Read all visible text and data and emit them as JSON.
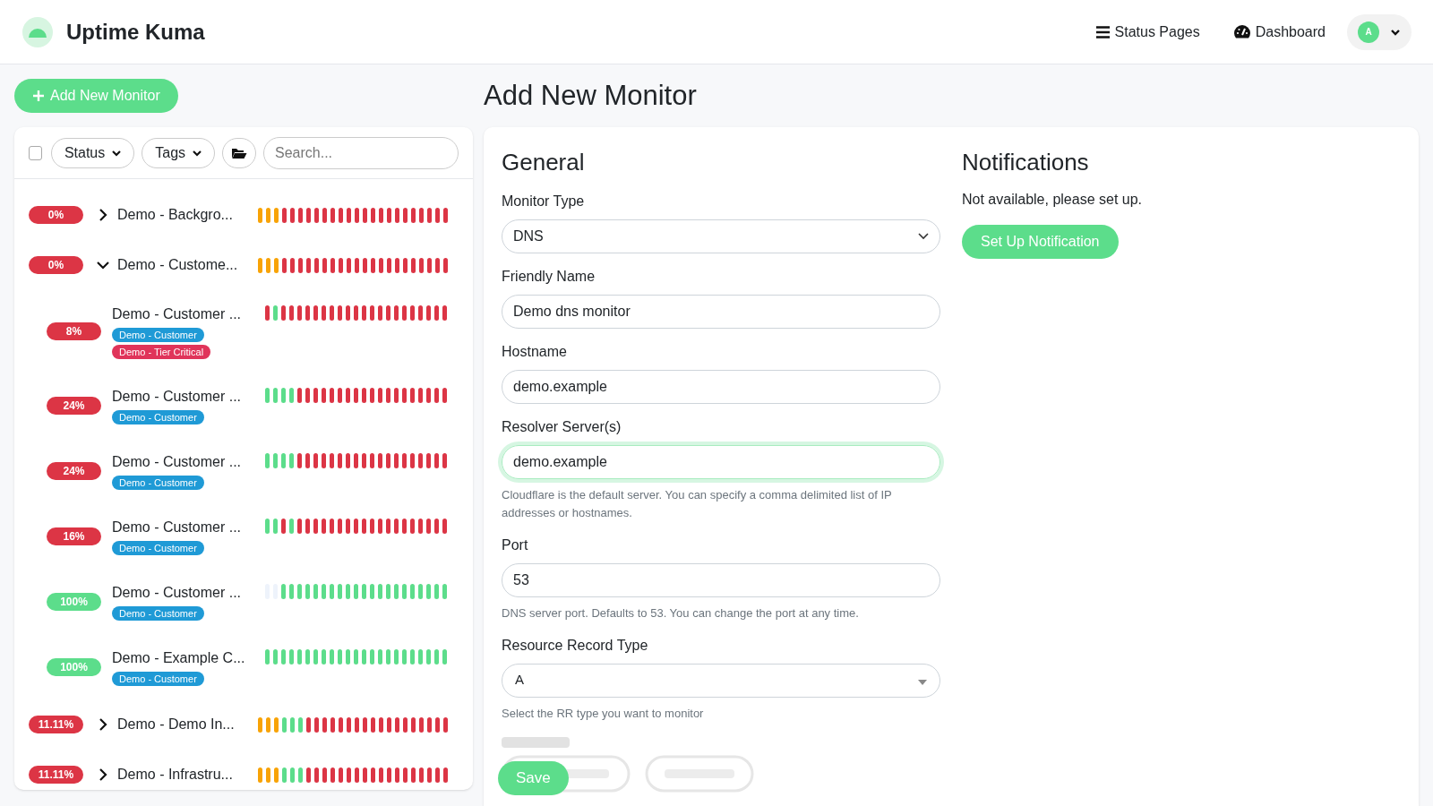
{
  "app": {
    "name": "Uptime Kuma"
  },
  "nav": [
    {
      "label": "Status Pages",
      "kind": "list"
    },
    {
      "label": "Dashboard",
      "kind": "gauge"
    }
  ],
  "user": {
    "initial": "A"
  },
  "add_button": "Add New Monitor",
  "filters": {
    "select_all_checked": false,
    "status": "Status",
    "tags": "Tags",
    "search_placeholder": "Search..."
  },
  "monitors": [
    {
      "uptime": "0%",
      "color": "#dc3545",
      "name": "Demo - Backgro...",
      "expanded": false,
      "beats": [
        {
          "color": "#f8a306"
        },
        {
          "color": "#f8a306"
        },
        {
          "color": "#f8a306"
        },
        {
          "color": "#dc3545"
        },
        {
          "color": "#dc3545"
        },
        {
          "color": "#dc3545"
        },
        {
          "color": "#dc3545"
        },
        {
          "color": "#dc3545"
        },
        {
          "color": "#dc3545"
        },
        {
          "color": "#dc3545"
        },
        {
          "color": "#dc3545"
        },
        {
          "color": "#dc3545"
        },
        {
          "color": "#dc3545"
        },
        {
          "color": "#dc3545"
        },
        {
          "color": "#dc3545"
        },
        {
          "color": "#dc3545"
        },
        {
          "color": "#dc3545"
        },
        {
          "color": "#dc3545"
        },
        {
          "color": "#dc3545"
        },
        {
          "color": "#dc3545"
        },
        {
          "color": "#dc3545"
        },
        {
          "color": "#dc3545"
        },
        {
          "color": "#dc3545"
        },
        {
          "color": "#dc3545"
        }
      ]
    },
    {
      "uptime": "0%",
      "color": "#dc3545",
      "name": "Demo - Custome...",
      "expanded": true,
      "beats": [
        {
          "color": "#f8a306"
        },
        {
          "color": "#f8a306"
        },
        {
          "color": "#f8a306"
        },
        {
          "color": "#dc3545"
        },
        {
          "color": "#dc3545"
        },
        {
          "color": "#dc3545"
        },
        {
          "color": "#dc3545"
        },
        {
          "color": "#dc3545"
        },
        {
          "color": "#dc3545"
        },
        {
          "color": "#dc3545"
        },
        {
          "color": "#dc3545"
        },
        {
          "color": "#dc3545"
        },
        {
          "color": "#dc3545"
        },
        {
          "color": "#dc3545"
        },
        {
          "color": "#dc3545"
        },
        {
          "color": "#dc3545"
        },
        {
          "color": "#dc3545"
        },
        {
          "color": "#dc3545"
        },
        {
          "color": "#dc3545"
        },
        {
          "color": "#dc3545"
        },
        {
          "color": "#dc3545"
        },
        {
          "color": "#dc3545"
        },
        {
          "color": "#dc3545"
        },
        {
          "color": "#dc3545"
        }
      ],
      "children": [
        {
          "uptime": "8%",
          "color": "#dc3545",
          "name": "Demo - Customer ...",
          "tags": [
            {
              "label": "Demo - Customer",
              "color": "#1f9ad6"
            },
            {
              "label": "Demo - Tier Critical",
              "color": "#e0345a"
            }
          ],
          "beats": [
            {
              "color": "#dc3545"
            },
            {
              "color": "#5cdd8b"
            },
            {
              "color": "#dc3545"
            },
            {
              "color": "#dc3545"
            },
            {
              "color": "#dc3545"
            },
            {
              "color": "#dc3545"
            },
            {
              "color": "#dc3545"
            },
            {
              "color": "#dc3545"
            },
            {
              "color": "#dc3545"
            },
            {
              "color": "#dc3545"
            },
            {
              "color": "#dc3545"
            },
            {
              "color": "#dc3545"
            },
            {
              "color": "#dc3545"
            },
            {
              "color": "#dc3545"
            },
            {
              "color": "#dc3545"
            },
            {
              "color": "#dc3545"
            },
            {
              "color": "#dc3545"
            },
            {
              "color": "#dc3545"
            },
            {
              "color": "#dc3545"
            },
            {
              "color": "#dc3545"
            },
            {
              "color": "#dc3545"
            },
            {
              "color": "#dc3545"
            },
            {
              "color": "#dc3545"
            }
          ]
        },
        {
          "uptime": "24%",
          "color": "#dc3545",
          "name": "Demo - Customer ...",
          "tags": [
            {
              "label": "Demo - Customer",
              "color": "#1f9ad6"
            }
          ],
          "beats": [
            {
              "color": "#5cdd8b"
            },
            {
              "color": "#5cdd8b"
            },
            {
              "color": "#5cdd8b"
            },
            {
              "color": "#5cdd8b"
            },
            {
              "color": "#dc3545"
            },
            {
              "color": "#dc3545"
            },
            {
              "color": "#dc3545"
            },
            {
              "color": "#dc3545"
            },
            {
              "color": "#dc3545"
            },
            {
              "color": "#dc3545"
            },
            {
              "color": "#dc3545"
            },
            {
              "color": "#dc3545"
            },
            {
              "color": "#dc3545"
            },
            {
              "color": "#dc3545"
            },
            {
              "color": "#dc3545"
            },
            {
              "color": "#dc3545"
            },
            {
              "color": "#dc3545"
            },
            {
              "color": "#dc3545"
            },
            {
              "color": "#dc3545"
            },
            {
              "color": "#dc3545"
            },
            {
              "color": "#dc3545"
            },
            {
              "color": "#dc3545"
            },
            {
              "color": "#dc3545"
            }
          ]
        },
        {
          "uptime": "24%",
          "color": "#dc3545",
          "name": "Demo - Customer ...",
          "tags": [
            {
              "label": "Demo - Customer",
              "color": "#1f9ad6"
            }
          ],
          "beats": [
            {
              "color": "#5cdd8b"
            },
            {
              "color": "#5cdd8b"
            },
            {
              "color": "#5cdd8b"
            },
            {
              "color": "#5cdd8b"
            },
            {
              "color": "#dc3545"
            },
            {
              "color": "#dc3545"
            },
            {
              "color": "#dc3545"
            },
            {
              "color": "#dc3545"
            },
            {
              "color": "#dc3545"
            },
            {
              "color": "#dc3545"
            },
            {
              "color": "#dc3545"
            },
            {
              "color": "#dc3545"
            },
            {
              "color": "#dc3545"
            },
            {
              "color": "#dc3545"
            },
            {
              "color": "#dc3545"
            },
            {
              "color": "#dc3545"
            },
            {
              "color": "#dc3545"
            },
            {
              "color": "#dc3545"
            },
            {
              "color": "#dc3545"
            },
            {
              "color": "#dc3545"
            },
            {
              "color": "#dc3545"
            },
            {
              "color": "#dc3545"
            },
            {
              "color": "#dc3545"
            }
          ]
        },
        {
          "uptime": "16%",
          "color": "#dc3545",
          "name": "Demo - Customer ...",
          "tags": [
            {
              "label": "Demo - Customer",
              "color": "#1f9ad6"
            }
          ],
          "beats": [
            {
              "color": "#5cdd8b"
            },
            {
              "color": "#5cdd8b"
            },
            {
              "color": "#dc3545"
            },
            {
              "color": "#5cdd8b"
            },
            {
              "color": "#dc3545"
            },
            {
              "color": "#dc3545"
            },
            {
              "color": "#dc3545"
            },
            {
              "color": "#dc3545"
            },
            {
              "color": "#dc3545"
            },
            {
              "color": "#dc3545"
            },
            {
              "color": "#dc3545"
            },
            {
              "color": "#dc3545"
            },
            {
              "color": "#dc3545"
            },
            {
              "color": "#dc3545"
            },
            {
              "color": "#dc3545"
            },
            {
              "color": "#dc3545"
            },
            {
              "color": "#dc3545"
            },
            {
              "color": "#dc3545"
            },
            {
              "color": "#dc3545"
            },
            {
              "color": "#dc3545"
            },
            {
              "color": "#dc3545"
            },
            {
              "color": "#dc3545"
            },
            {
              "color": "#dc3545"
            }
          ]
        },
        {
          "uptime": "100%",
          "color": "#5cdd8b",
          "name": "Demo - Customer ...",
          "tags": [
            {
              "label": "Demo - Customer",
              "color": "#1f9ad6"
            }
          ],
          "beats": [
            {
              "color": "#eef3fb"
            },
            {
              "color": "#eef3fb"
            },
            {
              "color": "#5cdd8b"
            },
            {
              "color": "#5cdd8b"
            },
            {
              "color": "#5cdd8b"
            },
            {
              "color": "#5cdd8b"
            },
            {
              "color": "#5cdd8b"
            },
            {
              "color": "#5cdd8b"
            },
            {
              "color": "#5cdd8b"
            },
            {
              "color": "#5cdd8b"
            },
            {
              "color": "#5cdd8b"
            },
            {
              "color": "#5cdd8b"
            },
            {
              "color": "#5cdd8b"
            },
            {
              "color": "#5cdd8b"
            },
            {
              "color": "#5cdd8b"
            },
            {
              "color": "#5cdd8b"
            },
            {
              "color": "#5cdd8b"
            },
            {
              "color": "#5cdd8b"
            },
            {
              "color": "#5cdd8b"
            },
            {
              "color": "#5cdd8b"
            },
            {
              "color": "#5cdd8b"
            },
            {
              "color": "#5cdd8b"
            },
            {
              "color": "#5cdd8b"
            }
          ]
        },
        {
          "uptime": "100%",
          "color": "#5cdd8b",
          "name": "Demo - Example C...",
          "tags": [
            {
              "label": "Demo - Customer",
              "color": "#1f9ad6"
            }
          ],
          "beats": [
            {
              "color": "#5cdd8b"
            },
            {
              "color": "#5cdd8b"
            },
            {
              "color": "#5cdd8b"
            },
            {
              "color": "#5cdd8b"
            },
            {
              "color": "#5cdd8b"
            },
            {
              "color": "#5cdd8b"
            },
            {
              "color": "#5cdd8b"
            },
            {
              "color": "#5cdd8b"
            },
            {
              "color": "#5cdd8b"
            },
            {
              "color": "#5cdd8b"
            },
            {
              "color": "#5cdd8b"
            },
            {
              "color": "#5cdd8b"
            },
            {
              "color": "#5cdd8b"
            },
            {
              "color": "#5cdd8b"
            },
            {
              "color": "#5cdd8b"
            },
            {
              "color": "#5cdd8b"
            },
            {
              "color": "#5cdd8b"
            },
            {
              "color": "#5cdd8b"
            },
            {
              "color": "#5cdd8b"
            },
            {
              "color": "#5cdd8b"
            },
            {
              "color": "#5cdd8b"
            },
            {
              "color": "#5cdd8b"
            },
            {
              "color": "#5cdd8b"
            }
          ]
        }
      ]
    },
    {
      "uptime": "11.11%",
      "color": "#dc3545",
      "name": "Demo - Demo In...",
      "expanded": false,
      "beats": [
        {
          "color": "#f8a306"
        },
        {
          "color": "#f8a306"
        },
        {
          "color": "#f8a306"
        },
        {
          "color": "#5cdd8b"
        },
        {
          "color": "#5cdd8b"
        },
        {
          "color": "#5cdd8b"
        },
        {
          "color": "#dc3545"
        },
        {
          "color": "#dc3545"
        },
        {
          "color": "#dc3545"
        },
        {
          "color": "#dc3545"
        },
        {
          "color": "#dc3545"
        },
        {
          "color": "#dc3545"
        },
        {
          "color": "#dc3545"
        },
        {
          "color": "#dc3545"
        },
        {
          "color": "#dc3545"
        },
        {
          "color": "#dc3545"
        },
        {
          "color": "#dc3545"
        },
        {
          "color": "#dc3545"
        },
        {
          "color": "#dc3545"
        },
        {
          "color": "#dc3545"
        },
        {
          "color": "#dc3545"
        },
        {
          "color": "#dc3545"
        },
        {
          "color": "#dc3545"
        },
        {
          "color": "#dc3545"
        }
      ]
    },
    {
      "uptime": "11.11%",
      "color": "#dc3545",
      "name": "Demo - Infrastru...",
      "expanded": false,
      "beats": [
        {
          "color": "#f8a306"
        },
        {
          "color": "#f8a306"
        },
        {
          "color": "#f8a306"
        },
        {
          "color": "#5cdd8b"
        },
        {
          "color": "#5cdd8b"
        },
        {
          "color": "#5cdd8b"
        },
        {
          "color": "#dc3545"
        },
        {
          "color": "#dc3545"
        },
        {
          "color": "#dc3545"
        },
        {
          "color": "#dc3545"
        },
        {
          "color": "#dc3545"
        },
        {
          "color": "#dc3545"
        },
        {
          "color": "#dc3545"
        },
        {
          "color": "#dc3545"
        },
        {
          "color": "#dc3545"
        },
        {
          "color": "#dc3545"
        },
        {
          "color": "#dc3545"
        },
        {
          "color": "#dc3545"
        },
        {
          "color": "#dc3545"
        },
        {
          "color": "#dc3545"
        },
        {
          "color": "#dc3545"
        },
        {
          "color": "#dc3545"
        },
        {
          "color": "#dc3545"
        },
        {
          "color": "#dc3545"
        }
      ]
    }
  ],
  "form": {
    "title": "Add New Monitor",
    "heading": "General",
    "fields": [
      {
        "kind": "select",
        "label": "Monitor Type",
        "value": "DNS"
      },
      {
        "kind": "text",
        "label": "Friendly Name",
        "value": "Demo dns monitor"
      },
      {
        "kind": "text",
        "label": "Hostname",
        "value": "demo.example"
      },
      {
        "kind": "text",
        "label": "Resolver Server(s)",
        "value": "demo.example",
        "focused": true,
        "help": "Cloudflare is the default server. You can specify a comma delimited list of IP addresses or hostnames."
      },
      {
        "kind": "text",
        "label": "Port",
        "value": "53",
        "help": "DNS server port. Defaults to 53. You can change the port at any time."
      },
      {
        "kind": "multiselect",
        "label": "Resource Record Type",
        "value": "A",
        "help": "Select the RR type you want to monitor"
      }
    ],
    "save": "Save"
  },
  "notifications": {
    "heading": "Notifications",
    "message": "Not available, please set up.",
    "button": "Set Up Notification"
  }
}
